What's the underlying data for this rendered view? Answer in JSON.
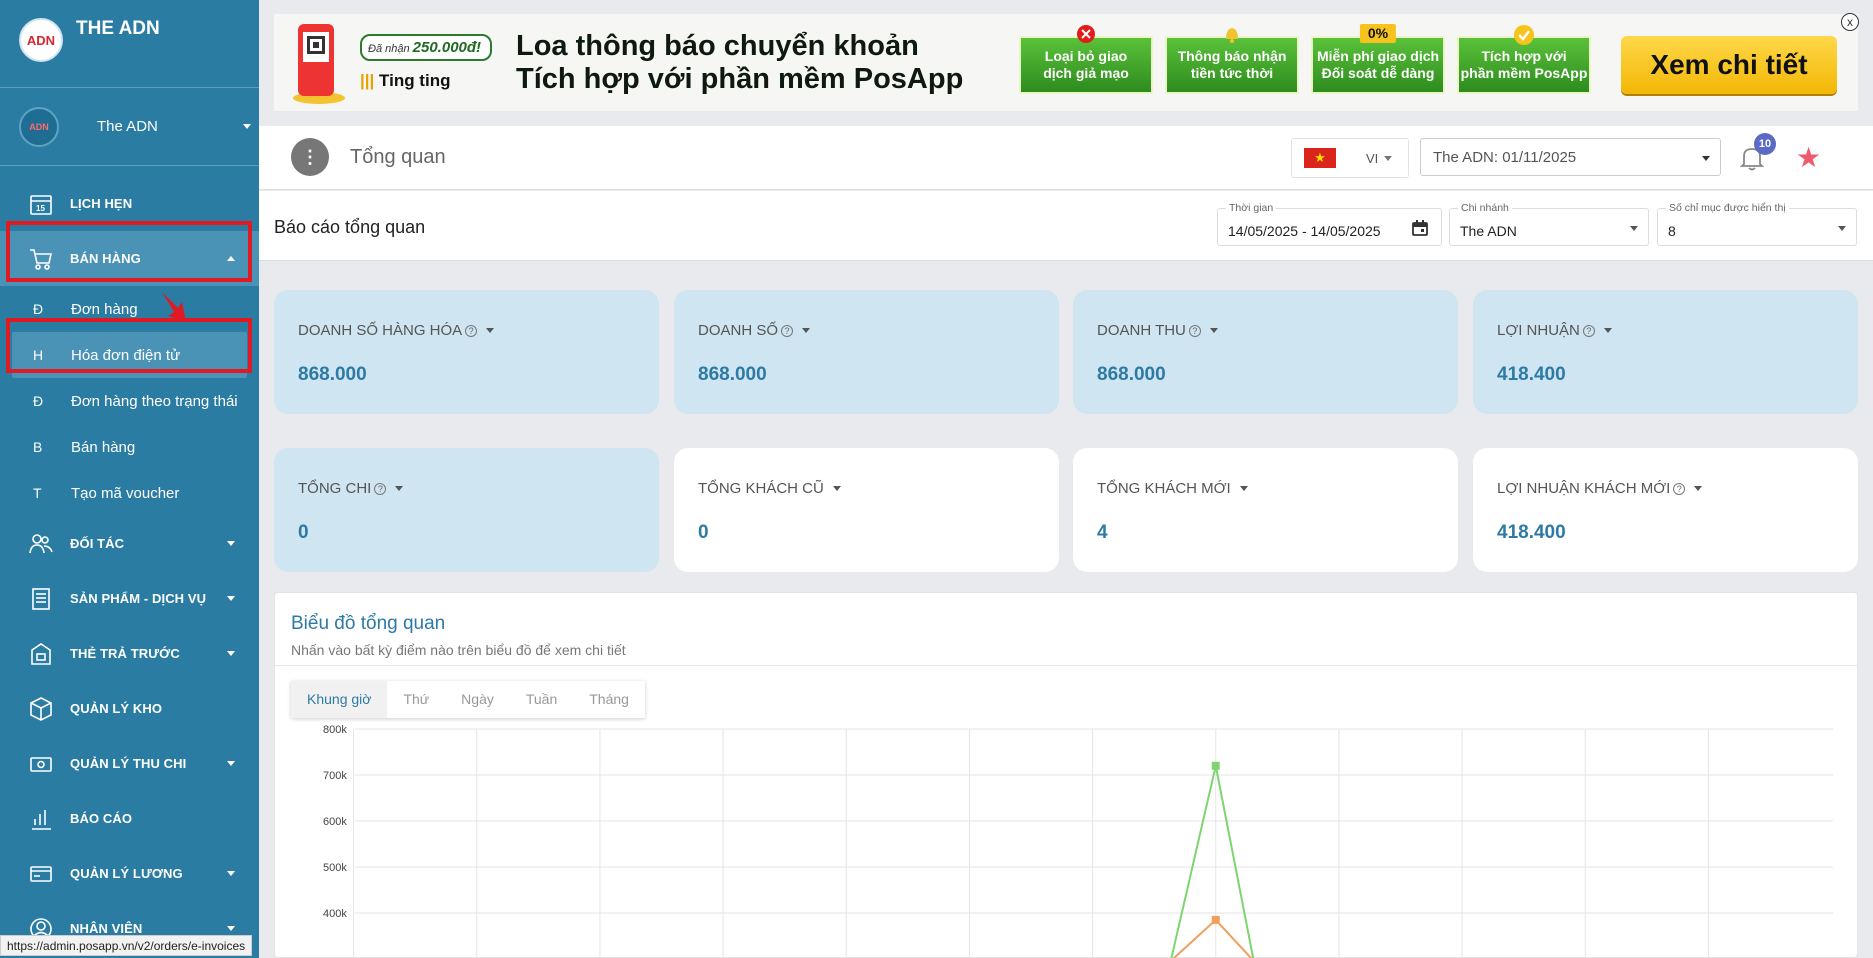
{
  "brand": {
    "name": "THE ADN",
    "logo_text": "ADN"
  },
  "account": {
    "name": "The ADN",
    "avatar_text": "ADN"
  },
  "sidebar": {
    "items": [
      {
        "key": "lich-hen",
        "label": "LỊCH HẸN",
        "icon": "calendar-icon",
        "has_caret": false
      },
      {
        "key": "ban-hang",
        "label": "BÁN HÀNG",
        "icon": "cart-icon",
        "has_caret": true,
        "expanded": true
      },
      {
        "key": "doi-tac",
        "label": "ĐỐI TÁC",
        "icon": "partners-icon",
        "has_caret": true
      },
      {
        "key": "san-pham",
        "label": "SẢN PHẨM - DỊCH VỤ",
        "icon": "products-icon",
        "has_caret": true
      },
      {
        "key": "the-tra-truoc",
        "label": "THẺ TRẢ TRƯỚC",
        "icon": "prepaid-card-icon",
        "has_caret": true
      },
      {
        "key": "quan-ly-kho",
        "label": "QUẢN LÝ KHO",
        "icon": "box-icon",
        "has_caret": false
      },
      {
        "key": "quan-ly-thu-chi",
        "label": "QUẢN LÝ THU CHI",
        "icon": "money-icon",
        "has_caret": true
      },
      {
        "key": "bao-cao",
        "label": "BÁO CÁO",
        "icon": "bar-chart-icon",
        "has_caret": false
      },
      {
        "key": "quan-ly-luong",
        "label": "QUẢN LÝ LƯƠNG",
        "icon": "payroll-card-icon",
        "has_caret": true
      },
      {
        "key": "nhan-vien",
        "label": "NHÂN VIÊN",
        "icon": "user-icon",
        "has_caret": true
      }
    ],
    "sub_items": [
      {
        "letter": "Đ",
        "label": "Đơn hàng"
      },
      {
        "letter": "H",
        "label": "Hóa đơn điện tử",
        "active": true
      },
      {
        "letter": "Đ",
        "label": "Đơn hàng theo trạng thái"
      },
      {
        "letter": "B",
        "label": "Bán hàng"
      },
      {
        "letter": "T",
        "label": "Tạo mã voucher"
      }
    ]
  },
  "banner": {
    "badge_text": "Đã nhận",
    "badge_amount": "250.000đ!",
    "ting": "Ting ting",
    "title_line1": "Loa thông báo chuyển khoản",
    "title_line2": "Tích hợp với phần mềm PosApp",
    "features": [
      {
        "line1": "Loại bỏ giao",
        "line2": "dịch giả mạo",
        "icon": "x-mark-icon"
      },
      {
        "line1": "Thông báo nhận",
        "line2": "tiền tức thời",
        "icon": "bell-icon"
      },
      {
        "line1": "Miễn phí giao dịch",
        "line2": "Đối soát dễ dàng",
        "icon": "zero-percent-icon",
        "icon_text": "0%"
      },
      {
        "line1": "Tích hợp với",
        "line2": "phần mềm PosApp",
        "icon": "check-icon"
      }
    ],
    "cta": "Xem chi tiết",
    "close": "x"
  },
  "header": {
    "title": "Tổng quan",
    "lang_code": "VI",
    "branch_date": "The ADN: 01/11/2025",
    "notification_count": "10"
  },
  "filters": {
    "report_title": "Báo cáo tổng quan",
    "time_label": "Thời gian",
    "time_value": "14/05/2025 - 14/05/2025",
    "branch_label": "Chi nhánh",
    "branch_value": "The ADN",
    "count_label": "Số chỉ mục được hiển thị",
    "count_value": "8"
  },
  "stats": [
    {
      "label": "DOANH SỐ HÀNG HÓA",
      "value": "868.000",
      "help": true
    },
    {
      "label": "DOANH SỐ",
      "value": "868.000",
      "help": true
    },
    {
      "label": "DOANH THU",
      "value": "868.000",
      "help": true
    },
    {
      "label": "LỢI NHUẬN",
      "value": "418.400",
      "help": true
    },
    {
      "label": "TỔNG CHI",
      "value": "0",
      "help": true
    },
    {
      "label": "TỔNG KHÁCH CŨ",
      "value": "0",
      "help": false
    },
    {
      "label": "TỔNG KHÁCH MỚI",
      "value": "4",
      "help": false
    },
    {
      "label": "LỢI NHUẬN KHÁCH MỚI",
      "value": "418.400",
      "help": true
    }
  ],
  "chart_panel": {
    "title": "Biểu đồ tổng quan",
    "subtitle": "Nhấn vào bất kỳ điểm nào trên biểu đồ để xem chi tiết",
    "tabs": [
      "Khung giờ",
      "Thứ",
      "Ngày",
      "Tuần",
      "Tháng"
    ],
    "active_tab": "Khung giờ"
  },
  "chart_data": {
    "type": "line",
    "y_ticks": [
      "800k",
      "700k",
      "600k",
      "500k",
      "400k"
    ],
    "ylim": [
      300000,
      800000
    ],
    "x_count": 12,
    "grid": true,
    "series": [
      {
        "color": "#7ed56f",
        "peak_index": 7,
        "peak_value": 720000
      },
      {
        "color": "#f0a05a",
        "peak_index": 7,
        "peak_value": 385000
      }
    ]
  },
  "status_url": "https://admin.posapp.vn/v2/orders/e-invoices"
}
